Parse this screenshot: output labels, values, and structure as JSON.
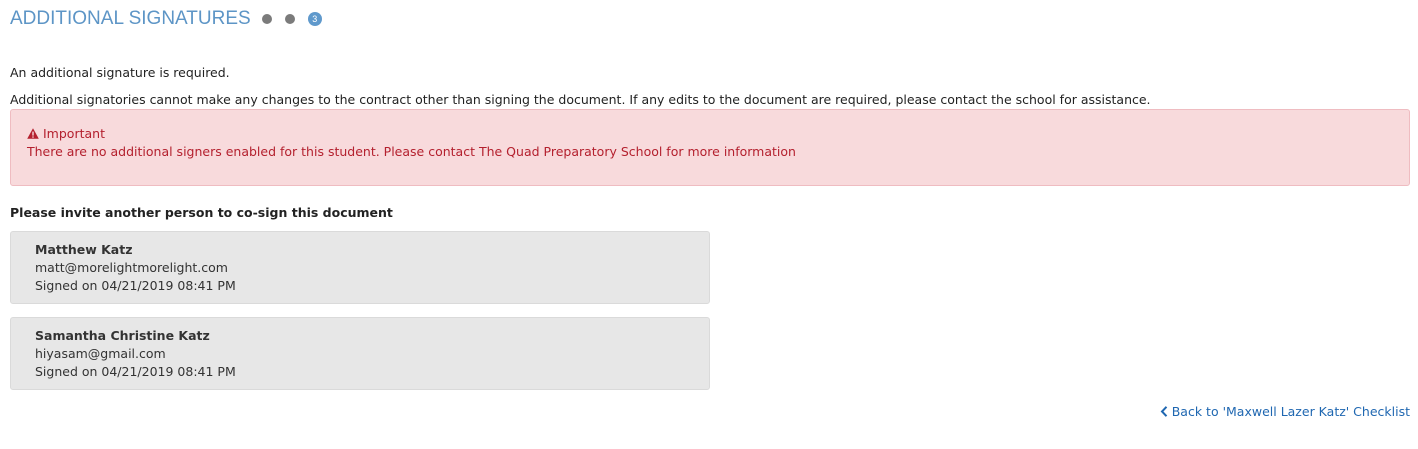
{
  "header": {
    "title": "ADDITIONAL SIGNATURES",
    "current_step": "3"
  },
  "intro": {
    "required_text": "An additional signature is required.",
    "notice_text": "Additional signatories cannot make any changes to the contract other than signing the document. If any edits to the document are required, please contact the school for assistance."
  },
  "alert": {
    "icon": "warning-triangle-icon",
    "title": "Important",
    "body": "There are no additional signers enabled for this student. Please contact The Quad Preparatory School for more information",
    "color": "#b4202e",
    "background": "#f8dadc"
  },
  "invite": {
    "label": "Please invite another person to co-sign this document"
  },
  "signers": [
    {
      "name": "Matthew Katz",
      "email": "matt@morelightmorelight.com",
      "signed": "Signed on 04/21/2019 08:41 PM"
    },
    {
      "name": "Samantha Christine Katz",
      "email": "hiyasam@gmail.com",
      "signed": "Signed on 04/21/2019 08:41 PM"
    }
  ],
  "back_link": {
    "icon": "chevron-left-icon",
    "label": "Back to 'Maxwell Lazer Katz' Checklist"
  },
  "colors": {
    "accent": "#5d95c6",
    "link": "#1f67b1"
  }
}
